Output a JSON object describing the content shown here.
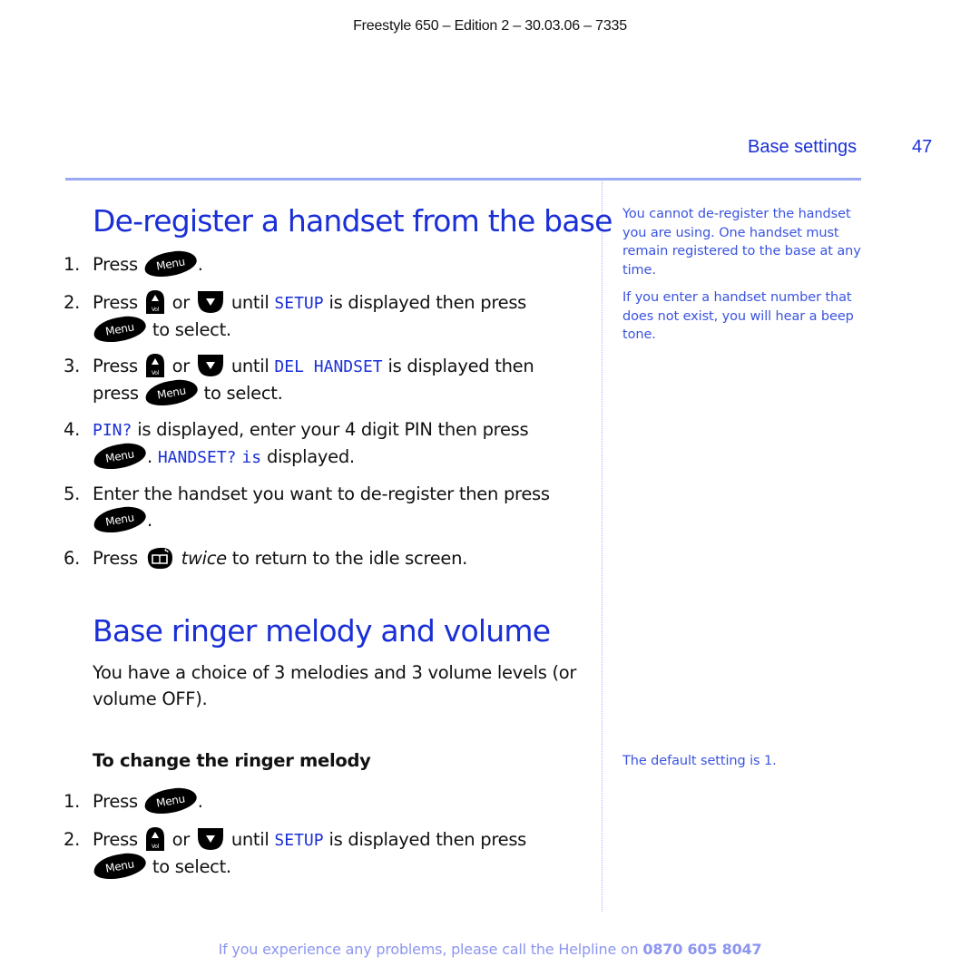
{
  "header": {
    "doc_info": "Freestyle 650 – Edition 2 – 30.03.06 – 7335",
    "section_name": "Base settings",
    "page_number": "47"
  },
  "keys": {
    "menu": "Menu",
    "vol": "Vol"
  },
  "section1": {
    "title": "De-register a handset from the base",
    "steps": [
      {
        "num": "1.",
        "pre": "Press",
        "post": "."
      },
      {
        "num": "2.",
        "pre": "Press",
        "or": "or",
        "until": "until",
        "lcd": "SETUP",
        "mid": "is displayed then press",
        "post": "to select."
      },
      {
        "num": "3.",
        "pre": "Press",
        "or": "or",
        "until": "until",
        "lcd": "DEL HANDSET",
        "mid": "is displayed then",
        "pre2": "press",
        "post": "to select."
      },
      {
        "num": "4.",
        "lcd": "PIN?",
        "mid": "is displayed, enter your 4 digit PIN then press",
        "post": ".",
        "lcd2": "HANDSET?",
        "lcd3": "is",
        "post2": "displayed."
      },
      {
        "num": "5.",
        "mid": "Enter the handset you want to de-register then press",
        "post": "."
      },
      {
        "num": "6.",
        "pre": "Press",
        "em": "twice",
        "post": "to return to the idle screen."
      }
    ]
  },
  "section2": {
    "title": "Base ringer melody and volume",
    "intro": "You have a choice of 3 melodies and 3 volume levels (or volume OFF).",
    "subhead": "To change the ringer melody",
    "steps": [
      {
        "num": "1.",
        "pre": "Press",
        "post": "."
      },
      {
        "num": "2.",
        "pre": "Press",
        "or": "or",
        "until": "until",
        "lcd": "SETUP",
        "mid": "is displayed then press",
        "post": "to select."
      }
    ]
  },
  "sidebar": {
    "note1": "You cannot de-register the handset you are using. One handset must remain registered to the base at any time.",
    "note2": "If you enter a handset number that does not exist, you will hear a beep tone.",
    "note3": "The default setting is 1."
  },
  "footer": {
    "text": "If you experience any problems, please call the Helpline on",
    "phone": "0870 605 8047"
  }
}
